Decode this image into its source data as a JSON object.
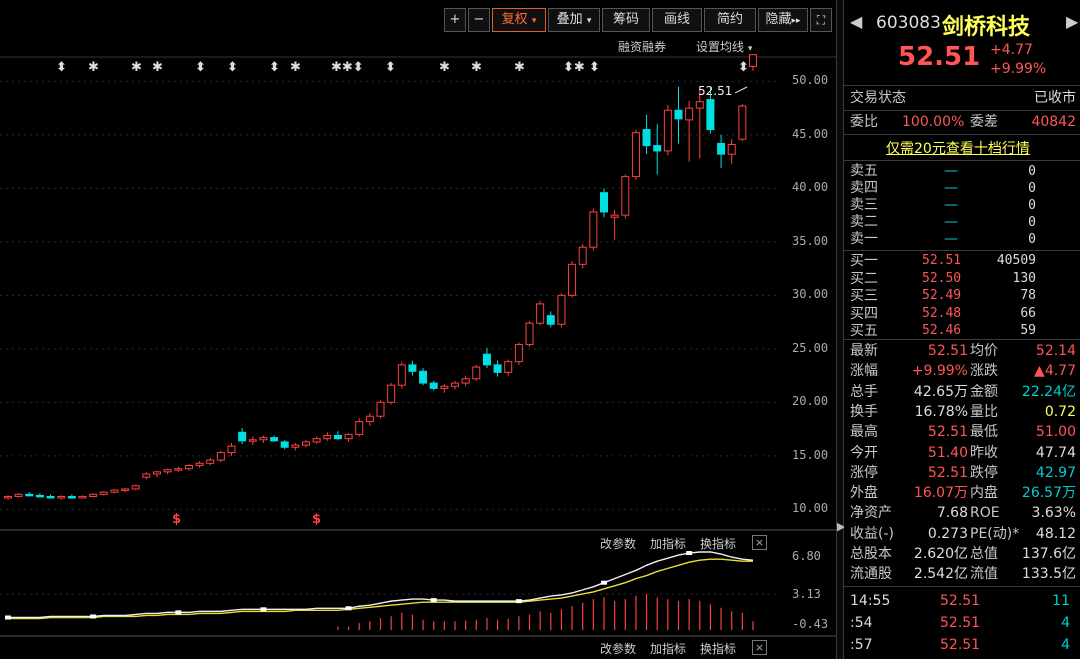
{
  "toolbar": {
    "plus": "+",
    "minus": "−",
    "fuquan": "复权",
    "diejia": "叠加",
    "chouma": "筹码",
    "huaxian": "画线",
    "jianyue": "简约",
    "yincang": "隐藏",
    "fullscreen_icon": "expand-icon"
  },
  "subbar": {
    "rongzi": "融资融券",
    "junxian": "设置均线"
  },
  "price_label": "52.51",
  "y_axis": [
    "50.00",
    "45.00",
    "40.00",
    "35.00",
    "30.00",
    "25.00",
    "20.00",
    "15.00",
    "10.00"
  ],
  "indicator1": {
    "gaican": "改参数",
    "jiazhibiao": "加指标",
    "huanzhibiao": "换指标",
    "close": "×",
    "y": [
      "6.80",
      "3.13",
      "-0.43"
    ]
  },
  "indicator2": {
    "gaican": "改参数",
    "jiazhibiao": "加指标",
    "huanzhibiao": "换指标",
    "close": "×"
  },
  "chart_data": {
    "type": "candlestick",
    "ylim": [
      9,
      52
    ],
    "candles": [
      [
        11.1,
        11.3,
        10.9,
        11.2
      ],
      [
        11.2,
        11.5,
        11.1,
        11.4
      ],
      [
        11.4,
        11.6,
        11.2,
        11.3
      ],
      [
        11.3,
        11.5,
        11.1,
        11.2
      ],
      [
        11.2,
        11.4,
        11.0,
        11.1
      ],
      [
        11.1,
        11.3,
        10.9,
        11.2
      ],
      [
        11.2,
        11.4,
        11.0,
        11.1
      ],
      [
        11.1,
        11.3,
        11.0,
        11.2
      ],
      [
        11.2,
        11.5,
        11.1,
        11.4
      ],
      [
        11.4,
        11.7,
        11.3,
        11.6
      ],
      [
        11.6,
        11.9,
        11.5,
        11.8
      ],
      [
        11.8,
        12.0,
        11.6,
        11.9
      ],
      [
        11.9,
        12.3,
        11.8,
        12.2
      ],
      [
        13.0,
        13.5,
        12.8,
        13.3
      ],
      [
        13.3,
        13.6,
        13.0,
        13.5
      ],
      [
        13.5,
        13.8,
        13.3,
        13.7
      ],
      [
        13.7,
        14.0,
        13.5,
        13.8
      ],
      [
        13.8,
        14.2,
        13.6,
        14.1
      ],
      [
        14.1,
        14.5,
        13.9,
        14.3
      ],
      [
        14.3,
        14.8,
        14.1,
        14.6
      ],
      [
        14.6,
        15.5,
        14.4,
        15.3
      ],
      [
        15.3,
        16.2,
        15.0,
        15.9
      ],
      [
        17.2,
        17.6,
        16.1,
        16.4
      ],
      [
        16.4,
        16.8,
        16.0,
        16.5
      ],
      [
        16.5,
        16.9,
        16.2,
        16.7
      ],
      [
        16.7,
        16.9,
        16.3,
        16.4
      ],
      [
        16.3,
        16.5,
        15.6,
        15.8
      ],
      [
        15.8,
        16.2,
        15.5,
        16.0
      ],
      [
        16.0,
        16.5,
        15.8,
        16.3
      ],
      [
        16.3,
        16.8,
        16.1,
        16.6
      ],
      [
        16.6,
        17.2,
        16.4,
        16.9
      ],
      [
        16.9,
        17.3,
        16.5,
        16.6
      ],
      [
        16.6,
        17.1,
        16.3,
        17.0
      ],
      [
        17.0,
        18.5,
        16.8,
        18.2
      ],
      [
        18.2,
        19.0,
        17.8,
        18.7
      ],
      [
        18.7,
        20.2,
        18.5,
        20.0
      ],
      [
        20.0,
        21.8,
        19.8,
        21.6
      ],
      [
        21.6,
        23.8,
        21.3,
        23.5
      ],
      [
        23.5,
        23.9,
        22.5,
        22.9
      ],
      [
        22.9,
        23.2,
        21.6,
        21.8
      ],
      [
        21.8,
        22.0,
        21.1,
        21.3
      ],
      [
        21.3,
        21.7,
        20.9,
        21.5
      ],
      [
        21.5,
        22.0,
        21.2,
        21.8
      ],
      [
        21.8,
        22.5,
        21.5,
        22.2
      ],
      [
        22.2,
        23.5,
        22.0,
        23.3
      ],
      [
        24.5,
        25.1,
        23.2,
        23.5
      ],
      [
        23.5,
        23.9,
        22.4,
        22.8
      ],
      [
        22.8,
        24.0,
        22.5,
        23.8
      ],
      [
        23.8,
        25.6,
        23.5,
        25.4
      ],
      [
        25.4,
        27.6,
        25.2,
        27.4
      ],
      [
        27.4,
        29.5,
        27.2,
        29.2
      ],
      [
        28.1,
        28.5,
        27.0,
        27.3
      ],
      [
        27.3,
        30.2,
        27.0,
        30.0
      ],
      [
        30.0,
        33.2,
        29.8,
        32.9
      ],
      [
        32.9,
        34.8,
        32.5,
        34.5
      ],
      [
        34.5,
        38.1,
        34.2,
        37.8
      ],
      [
        39.6,
        40.0,
        37.3,
        37.8
      ],
      [
        37.3,
        38.0,
        35.2,
        37.5
      ],
      [
        37.5,
        41.3,
        37.2,
        41.1
      ],
      [
        41.1,
        45.5,
        40.8,
        45.2
      ],
      [
        45.5,
        46.9,
        43.2,
        44.0
      ],
      [
        44.0,
        46.0,
        41.3,
        43.5
      ],
      [
        43.5,
        47.8,
        43.1,
        47.3
      ],
      [
        47.3,
        49.5,
        44.2,
        46.5
      ],
      [
        46.4,
        48.2,
        42.5,
        47.5
      ],
      [
        47.5,
        49.2,
        42.8,
        48.1
      ],
      [
        48.3,
        49.5,
        45.1,
        45.5
      ],
      [
        44.2,
        45.0,
        41.9,
        43.2
      ],
      [
        43.2,
        44.6,
        42.3,
        44.1
      ],
      [
        44.6,
        47.9,
        44.4,
        47.7
      ],
      [
        51.4,
        52.5,
        51.0,
        52.5
      ]
    ],
    "volume": [
      2,
      2,
      2,
      2,
      2,
      2,
      2,
      2,
      2,
      2,
      2,
      2,
      3,
      3,
      3,
      3,
      3,
      3,
      3,
      3,
      4,
      4,
      5,
      4,
      4,
      4,
      4,
      4,
      4,
      4,
      4,
      4,
      4,
      8,
      10,
      14,
      16,
      20,
      18,
      12,
      10,
      10,
      10,
      11,
      12,
      14,
      12,
      13,
      16,
      18,
      22,
      20,
      24,
      28,
      32,
      36,
      38,
      34,
      36,
      40,
      42,
      38,
      36,
      34,
      36,
      34,
      30,
      26,
      22,
      20,
      10
    ],
    "line_white": [
      0.4,
      0.4,
      0.4,
      0.4,
      0.5,
      0.5,
      0.5,
      0.5,
      0.5,
      0.6,
      0.6,
      0.6,
      0.7,
      0.8,
      0.8,
      0.9,
      0.9,
      0.9,
      1.0,
      1.0,
      1.0,
      1.1,
      1.2,
      1.2,
      1.2,
      1.2,
      1.2,
      1.2,
      1.2,
      1.3,
      1.3,
      1.3,
      1.3,
      1.5,
      1.6,
      1.8,
      2.0,
      2.1,
      2.2,
      2.2,
      2.1,
      2.1,
      2.0,
      2.0,
      2.0,
      2.0,
      2.0,
      2.0,
      2.0,
      2.1,
      2.3,
      2.5,
      2.6,
      2.8,
      3.1,
      3.4,
      3.8,
      4.2,
      4.6,
      5.0,
      5.5,
      5.9,
      6.2,
      6.5,
      6.7,
      6.8,
      6.8,
      6.6,
      6.3,
      6.1,
      6.0
    ],
    "line_yellow": [
      0.3,
      0.3,
      0.3,
      0.3,
      0.4,
      0.4,
      0.4,
      0.4,
      0.4,
      0.5,
      0.5,
      0.5,
      0.5,
      0.6,
      0.6,
      0.7,
      0.7,
      0.7,
      0.8,
      0.8,
      0.8,
      0.9,
      1.0,
      1.0,
      1.0,
      1.0,
      1.0,
      1.1,
      1.1,
      1.1,
      1.1,
      1.1,
      1.2,
      1.3,
      1.4,
      1.5,
      1.6,
      1.7,
      1.8,
      1.9,
      1.9,
      1.9,
      1.9,
      1.9,
      1.9,
      1.9,
      1.9,
      1.9,
      1.9,
      2.0,
      2.1,
      2.2,
      2.3,
      2.5,
      2.7,
      2.9,
      3.2,
      3.5,
      3.8,
      4.2,
      4.5,
      4.9,
      5.2,
      5.5,
      5.8,
      6.0,
      6.1,
      6.1,
      6.0,
      5.9,
      5.9
    ],
    "stars": [
      "⬍",
      "✱",
      "✱",
      "✱",
      "⬍",
      "⬍",
      "⬍",
      "✱",
      "✱✱⬍",
      "⬍",
      "✱",
      "✱",
      "✱",
      "⬍✱",
      "⬍",
      "⬍"
    ],
    "signals": [
      "$",
      "$"
    ]
  },
  "quote": {
    "code": "603083",
    "name": "剑桥科技",
    "price": "52.51",
    "change": "+4.77",
    "pct": "+9.99%",
    "status_label": "交易状态",
    "status": "已收市",
    "weibi_label": "委比",
    "weibi": "100.00%",
    "weicha_label": "委差",
    "weicha": "40842",
    "ten_level": "仅需20元查看十档行情"
  },
  "asks": [
    {
      "label": "卖五",
      "price": "—",
      "vol": "0"
    },
    {
      "label": "卖四",
      "price": "—",
      "vol": "0"
    },
    {
      "label": "卖三",
      "price": "—",
      "vol": "0"
    },
    {
      "label": "卖二",
      "price": "—",
      "vol": "0"
    },
    {
      "label": "卖一",
      "price": "—",
      "vol": "0"
    }
  ],
  "bids": [
    {
      "label": "买一",
      "price": "52.51",
      "vol": "40509"
    },
    {
      "label": "买二",
      "price": "52.50",
      "vol": "130"
    },
    {
      "label": "买三",
      "price": "52.49",
      "vol": "78"
    },
    {
      "label": "买四",
      "price": "52.48",
      "vol": "66"
    },
    {
      "label": "买五",
      "price": "52.46",
      "vol": "59"
    }
  ],
  "stats": [
    {
      "l1": "最新",
      "v1": "52.51",
      "c1": "r",
      "l2": "均价",
      "v2": "52.14",
      "c2": "r"
    },
    {
      "l1": "涨幅",
      "v1": "+9.99%",
      "c1": "r",
      "l2": "涨跌",
      "v2": "▲4.77",
      "c2": "r"
    },
    {
      "l1": "总手",
      "v1": "42.65万",
      "c1": "w",
      "l2": "金额",
      "v2": "22.24亿",
      "c2": "g"
    },
    {
      "l1": "换手",
      "v1": "16.78%",
      "c1": "w",
      "l2": "量比",
      "v2": "0.72",
      "c2": "y"
    },
    {
      "l1": "最高",
      "v1": "52.51",
      "c1": "r",
      "l2": "最低",
      "v2": "51.00",
      "c2": "r"
    },
    {
      "l1": "今开",
      "v1": "51.40",
      "c1": "r",
      "l2": "昨收",
      "v2": "47.74",
      "c2": "w"
    },
    {
      "l1": "涨停",
      "v1": "52.51",
      "c1": "r",
      "l2": "跌停",
      "v2": "42.97",
      "c2": "g"
    },
    {
      "l1": "外盘",
      "v1": "16.07万",
      "c1": "r",
      "l2": "内盘",
      "v2": "26.57万",
      "c2": "g"
    },
    {
      "l1": "净资产",
      "v1": "7.68",
      "c1": "w",
      "l2": "ROE",
      "v2": "3.63%",
      "c2": "w"
    },
    {
      "l1": "收益(-)",
      "v1": "0.273",
      "c1": "w",
      "l2": "PE(动)*",
      "v2": "48.12",
      "c2": "w"
    },
    {
      "l1": "总股本",
      "v1": "2.620亿",
      "c1": "w",
      "l2": "总值",
      "v2": "137.6亿",
      "c2": "w"
    },
    {
      "l1": "流通股",
      "v1": "2.542亿",
      "c1": "w",
      "l2": "流值",
      "v2": "133.5亿",
      "c2": "w"
    }
  ],
  "ticks": [
    {
      "time": "14:55",
      "price": "52.51",
      "vol": "11"
    },
    {
      "time": ":54",
      "price": "52.51",
      "vol": "4"
    },
    {
      "time": ":57",
      "price": "52.51",
      "vol": "4"
    }
  ],
  "colors": {
    "up": "#ff4040",
    "down": "#00e0e0",
    "line_white": "#f0f0f0",
    "line_yellow": "#e8e030"
  }
}
